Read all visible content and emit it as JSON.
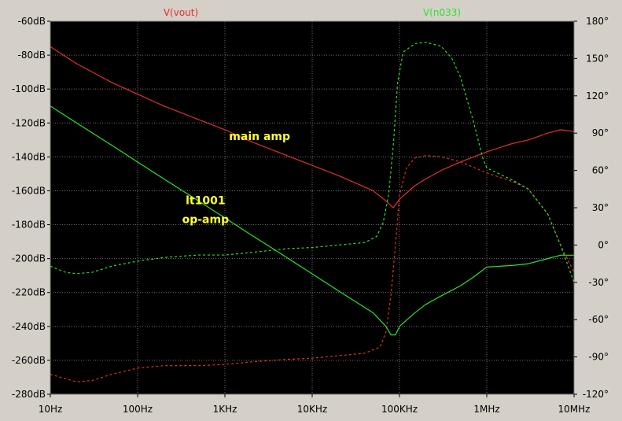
{
  "chart_data": {
    "type": "line",
    "x_scale": "log",
    "xlim": [
      10,
      10000000
    ],
    "x_ticks": [
      {
        "value": 10,
        "label": "10Hz"
      },
      {
        "value": 100,
        "label": "100Hz"
      },
      {
        "value": 1000,
        "label": "1KHz"
      },
      {
        "value": 10000,
        "label": "10KHz"
      },
      {
        "value": 100000,
        "label": "100KHz"
      },
      {
        "value": 1000000,
        "label": "1MHz"
      },
      {
        "value": 10000000,
        "label": "10MHz"
      }
    ],
    "y_left": {
      "unit": "dB",
      "lim": [
        -280,
        -60
      ],
      "ticks": [
        {
          "value": -60,
          "label": "-60dB"
        },
        {
          "value": -80,
          "label": "-80dB"
        },
        {
          "value": -100,
          "label": "-100dB"
        },
        {
          "value": -120,
          "label": "-120dB"
        },
        {
          "value": -140,
          "label": "-140dB"
        },
        {
          "value": -160,
          "label": "-160dB"
        },
        {
          "value": -180,
          "label": "-180dB"
        },
        {
          "value": -200,
          "label": "-200dB"
        },
        {
          "value": -220,
          "label": "-220dB"
        },
        {
          "value": -240,
          "label": "-240dB"
        },
        {
          "value": -260,
          "label": "-260dB"
        },
        {
          "value": -280,
          "label": "-280dB"
        }
      ]
    },
    "y_right": {
      "unit": "°",
      "lim": [
        -120,
        180
      ],
      "ticks": [
        {
          "value": 180,
          "label": "180°"
        },
        {
          "value": 150,
          "label": "150°"
        },
        {
          "value": 120,
          "label": "120°"
        },
        {
          "value": 90,
          "label": "90°"
        },
        {
          "value": 60,
          "label": "60°"
        },
        {
          "value": 30,
          "label": "30°"
        },
        {
          "value": 0,
          "label": "0°"
        },
        {
          "value": -30,
          "label": "-30°"
        },
        {
          "value": -60,
          "label": "-60°"
        },
        {
          "value": -90,
          "label": "-90°"
        },
        {
          "value": -120,
          "label": "-120°"
        }
      ]
    },
    "grid": true,
    "legend": [
      {
        "name": "V(vout)",
        "color": "#e03030"
      },
      {
        "name": "V(n033)",
        "color": "#30e030"
      }
    ],
    "annotations": [
      {
        "text": "main amp",
        "x": 2500,
        "y": -130
      },
      {
        "text": "lt1001",
        "x": 600,
        "y": -168
      },
      {
        "text": "op-amp",
        "x": 600,
        "y": -179
      }
    ],
    "series": [
      {
        "name": "V(vout)",
        "kind": "magnitude",
        "axis": "left",
        "color": "#e03030",
        "dash": "none",
        "points": [
          [
            10,
            -75
          ],
          [
            20,
            -85
          ],
          [
            50,
            -96
          ],
          [
            100,
            -103
          ],
          [
            200,
            -110
          ],
          [
            500,
            -118
          ],
          [
            1000,
            -124
          ],
          [
            2000,
            -131
          ],
          [
            5000,
            -139
          ],
          [
            10000,
            -145
          ],
          [
            20000,
            -151
          ],
          [
            50000,
            -160
          ],
          [
            70000,
            -166
          ],
          [
            85000,
            -170
          ],
          [
            100000,
            -165
          ],
          [
            150000,
            -157
          ],
          [
            200000,
            -153
          ],
          [
            300000,
            -148
          ],
          [
            500000,
            -143
          ],
          [
            1000000,
            -137
          ],
          [
            2000000,
            -132
          ],
          [
            3000000,
            -130
          ],
          [
            5000000,
            -126
          ],
          [
            7000000,
            -124
          ],
          [
            10000000,
            -125
          ]
        ]
      },
      {
        "name": "V(vout)",
        "kind": "phase",
        "axis": "right",
        "color": "#e03030",
        "dash": "3,3",
        "points": [
          [
            10,
            -104
          ],
          [
            20,
            -110
          ],
          [
            30,
            -109
          ],
          [
            50,
            -104
          ],
          [
            100,
            -99
          ],
          [
            200,
            -97
          ],
          [
            500,
            -97
          ],
          [
            1000,
            -96
          ],
          [
            2000,
            -94
          ],
          [
            5000,
            -92
          ],
          [
            10000,
            -91
          ],
          [
            20000,
            -89
          ],
          [
            40000,
            -87
          ],
          [
            60000,
            -82
          ],
          [
            70000,
            -70
          ],
          [
            80000,
            -40
          ],
          [
            90000,
            0
          ],
          [
            100000,
            40
          ],
          [
            120000,
            62
          ],
          [
            150000,
            70
          ],
          [
            200000,
            72
          ],
          [
            300000,
            71
          ],
          [
            500000,
            67
          ],
          [
            1000000,
            58
          ],
          [
            2000000,
            51
          ],
          [
            3000000,
            45
          ],
          [
            5000000,
            25
          ],
          [
            7000000,
            0
          ],
          [
            10000000,
            -22
          ]
        ]
      },
      {
        "name": "V(n033)",
        "kind": "magnitude",
        "axis": "left",
        "color": "#30e030",
        "dash": "none",
        "points": [
          [
            10,
            -110
          ],
          [
            20,
            -120
          ],
          [
            50,
            -133
          ],
          [
            100,
            -143
          ],
          [
            200,
            -153
          ],
          [
            500,
            -166
          ],
          [
            1000,
            -176
          ],
          [
            2000,
            -186
          ],
          [
            5000,
            -199
          ],
          [
            10000,
            -209
          ],
          [
            20000,
            -219
          ],
          [
            50000,
            -232
          ],
          [
            70000,
            -240
          ],
          [
            80000,
            -245
          ],
          [
            90000,
            -245
          ],
          [
            100000,
            -240
          ],
          [
            150000,
            -232
          ],
          [
            200000,
            -227
          ],
          [
            300000,
            -222
          ],
          [
            500000,
            -216
          ],
          [
            700000,
            -211
          ],
          [
            1000000,
            -205
          ],
          [
            2000000,
            -204
          ],
          [
            3000000,
            -203
          ],
          [
            5000000,
            -200
          ],
          [
            7000000,
            -198
          ],
          [
            10000000,
            -198
          ]
        ]
      },
      {
        "name": "V(n033)",
        "kind": "phase",
        "axis": "right",
        "color": "#30e030",
        "dash": "3,3",
        "points": [
          [
            10,
            -17
          ],
          [
            15,
            -22
          ],
          [
            20,
            -23
          ],
          [
            30,
            -22
          ],
          [
            50,
            -17
          ],
          [
            100,
            -13
          ],
          [
            200,
            -10
          ],
          [
            500,
            -8
          ],
          [
            1000,
            -8
          ],
          [
            2000,
            -6
          ],
          [
            5000,
            -3
          ],
          [
            10000,
            -2
          ],
          [
            20000,
            0
          ],
          [
            40000,
            2
          ],
          [
            55000,
            7
          ],
          [
            65000,
            18
          ],
          [
            75000,
            40
          ],
          [
            85000,
            80
          ],
          [
            95000,
            130
          ],
          [
            110000,
            155
          ],
          [
            150000,
            162
          ],
          [
            200000,
            163
          ],
          [
            300000,
            160
          ],
          [
            400000,
            150
          ],
          [
            500000,
            135
          ],
          [
            700000,
            100
          ],
          [
            900000,
            70
          ],
          [
            1000000,
            62
          ],
          [
            2000000,
            52
          ],
          [
            3000000,
            45
          ],
          [
            5000000,
            25
          ],
          [
            7000000,
            0
          ],
          [
            10000000,
            -30
          ]
        ]
      }
    ]
  }
}
